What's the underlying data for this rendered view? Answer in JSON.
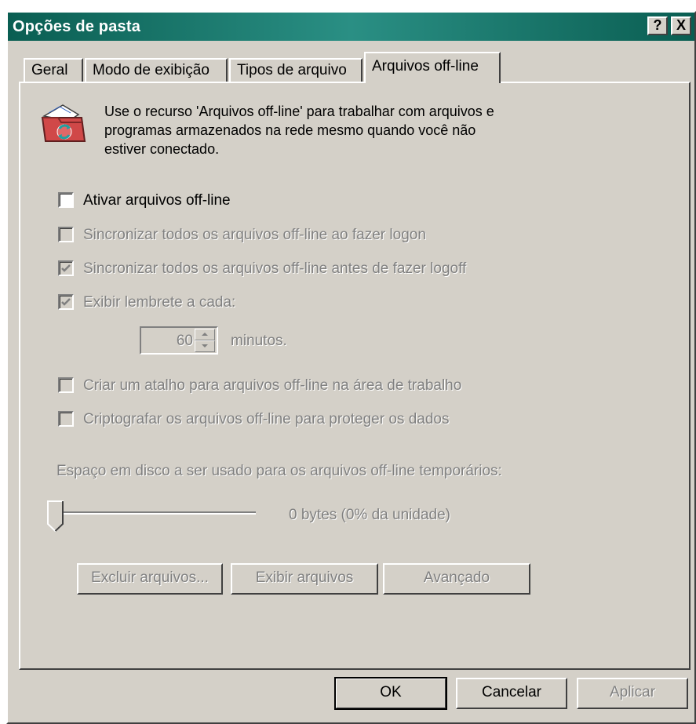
{
  "window": {
    "title": "Opções de pasta",
    "help_label": "?",
    "close_label": "X"
  },
  "tabs": [
    {
      "label": "Geral",
      "active": false
    },
    {
      "label": "Modo de exibição",
      "active": false
    },
    {
      "label": "Tipos de arquivo",
      "active": false
    },
    {
      "label": "Arquivos off-line",
      "active": true
    }
  ],
  "description": {
    "icon": "offline-files-folder-icon",
    "lines": [
      "Use o recurso 'Arquivos off-line' para trabalhar com arquivos e",
      "programas armazenados na rede mesmo quando você não",
      "estiver conectado."
    ]
  },
  "options": {
    "enable": {
      "label": "Ativar arquivos off-line",
      "checked": false,
      "enabled": true
    },
    "sync_logon": {
      "label": "Sincronizar todos os arquivos off-line ao fazer logon",
      "checked": false,
      "enabled": false
    },
    "sync_logoff": {
      "label": "Sincronizar todos os arquivos off-line antes de fazer logoff",
      "checked": true,
      "enabled": false
    },
    "reminder": {
      "label": "Exibir lembrete a cada:",
      "checked": true,
      "enabled": false
    },
    "reminder_minutes": {
      "value": "60",
      "unit": "minutos."
    },
    "shortcut": {
      "label": "Criar um atalho para arquivos off-line na área de trabalho",
      "checked": false,
      "enabled": false
    },
    "encrypt": {
      "label": "Criptografar os arquivos off-line para proteger os dados",
      "checked": false,
      "enabled": false
    }
  },
  "disk_space": {
    "label": "Espaço em disco a ser usado para os arquivos off-line temporários:",
    "slider_value_percent": 0,
    "value_text": "0 bytes (0% da unidade)"
  },
  "actions": {
    "delete_files": "Excluir arquivos...",
    "view_files": "Exibir arquivos",
    "advanced": "Avançado"
  },
  "footer": {
    "ok": "OK",
    "cancel": "Cancelar",
    "apply": "Aplicar"
  }
}
